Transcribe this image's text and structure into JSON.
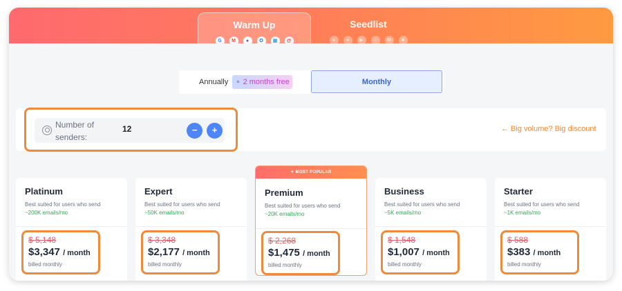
{
  "tabs": [
    {
      "label": "Warm Up",
      "active": true
    },
    {
      "label": "Seedlist",
      "active": false
    }
  ],
  "provider_icons": [
    "google-icon",
    "gmail-icon",
    "generic-provider-icon",
    "outlook-icon",
    "office365-icon",
    "at-mail-icon"
  ],
  "seedlist_icons": [
    "icon-1",
    "icon-2",
    "icon-3",
    "icon-4",
    "icon-5",
    "icon-6"
  ],
  "billing": {
    "annual_label": "Annually",
    "annual_badge": "2 months free",
    "monthly_label": "Monthly",
    "selected": "Monthly"
  },
  "senders": {
    "label": "Number of senders:",
    "value": "12",
    "minus": "−",
    "plus": "+"
  },
  "discount_link": "← Big volume? Big discount",
  "plans": [
    {
      "name": "Platinum",
      "desc": "Best suited for users who send",
      "emails": "~200K emails/mo",
      "old_price": "$ 5,148",
      "price": "$3,347",
      "per": "/ month",
      "billed": "billed monthly"
    },
    {
      "name": "Expert",
      "desc": "Best suited for users who send",
      "emails": "~50K emails/mo",
      "old_price": "$ 3,348",
      "price": "$2,177",
      "per": "/ month",
      "billed": "billed monthly"
    },
    {
      "name": "Premium",
      "desc": "Best suited for users who send",
      "emails": "~20K emails/mo",
      "old_price": "$ 2,268",
      "price": "$1,475",
      "per": "/ month",
      "billed": "billed monthly",
      "ribbon": "MOST POPULAR"
    },
    {
      "name": "Business",
      "desc": "Best suited for users who send",
      "emails": "~5K emails/mo",
      "old_price": "$ 1,548",
      "price": "$1,007",
      "per": "/ month",
      "billed": "billed monthly"
    },
    {
      "name": "Starter",
      "desc": "Best suited for users who send",
      "emails": "~1K emails/mo",
      "old_price": "$ 588",
      "price": "$383",
      "per": "/ month",
      "billed": "billed monthly"
    }
  ],
  "colors": {
    "accent_orange": "#ee8a3c",
    "primary_blue": "#4f86f7",
    "strike_red": "#e0626b",
    "emails_green": "#3aa35a"
  }
}
